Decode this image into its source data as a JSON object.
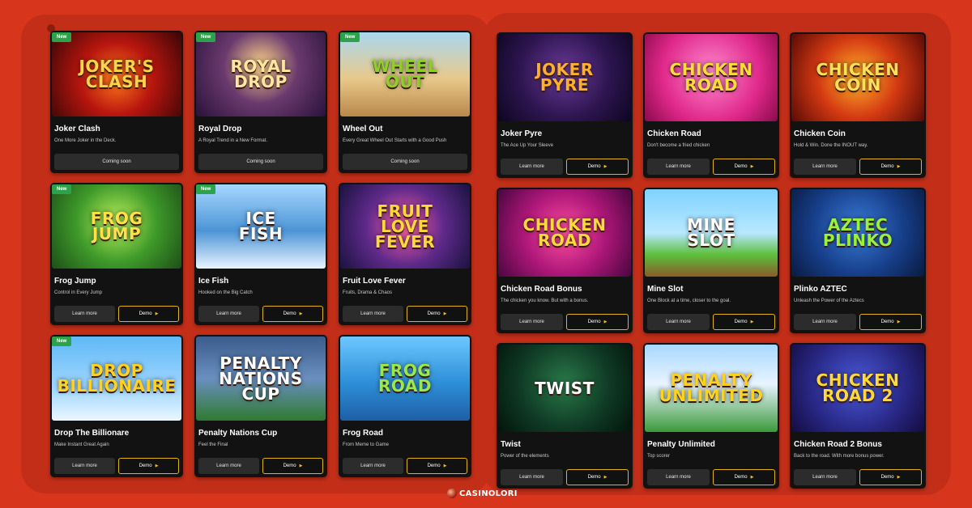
{
  "brand": {
    "logo_text": "CASINOLORI"
  },
  "labels": {
    "learn_more": "Learn more",
    "demo": "Demo",
    "coming_soon": "Coming soon",
    "new_badge": "New"
  },
  "colors": {
    "background": "#d8361c",
    "panel": "#c32e19",
    "card": "#121212",
    "demo_border": "#e2b317",
    "new_badge": "#2ca24b"
  },
  "games_left": [
    {
      "name": "Joker Clash",
      "tagline": "One More Joker in the Deck.",
      "thumb_text": "JOKER'S\nCLASH",
      "status": "coming_soon",
      "is_new": true,
      "bg": "radial-gradient(circle at 50% 55%, #ff7a1a 0%, #b8160f 45%, #3a0606 100%)",
      "fg": "#ffd54a"
    },
    {
      "name": "Royal Drop",
      "tagline": "A Royal Trend in a New Format.",
      "thumb_text": "ROYAL\nDROP",
      "status": "coming_soon",
      "is_new": true,
      "bg": "radial-gradient(circle at 50% 40%, #ffd68a 0%, #6b3a6e 45%, #2a123a 100%)",
      "fg": "#ffe6a0"
    },
    {
      "name": "Wheel Out",
      "tagline": "Every Great Wheel Out Starts with a Good Push",
      "thumb_text": "WHEEL\nOUT",
      "status": "coming_soon",
      "is_new": true,
      "bg": "linear-gradient(180deg, #a9d8f0 0%, #e8c98a 55%, #b9874a 100%)",
      "fg": "#8fcf2a"
    },
    {
      "name": "Frog Jump",
      "tagline": "Control in Every Jump",
      "thumb_text": "FROG\nJUMP",
      "status": "available",
      "is_new": true,
      "bg": "radial-gradient(circle at 50% 45%, #b9ef5a 0%, #3f9a2a 50%, #1d4f18 100%)",
      "fg": "#ffe14a"
    },
    {
      "name": "Ice Fish",
      "tagline": "Hooked on the Big Catch",
      "thumb_text": "ICE\nFISH",
      "status": "available",
      "is_new": true,
      "bg": "linear-gradient(180deg, #a6d8ff 0%, #4c94d6 55%, #e8f4ff 100%)",
      "fg": "#ffffff"
    },
    {
      "name": "Fruit Love Fever",
      "tagline": "Fruits, Drama & Chaos",
      "thumb_text": "FRUIT\nLOVE\nFEVER",
      "status": "available",
      "is_new": false,
      "bg": "radial-gradient(circle at 50% 50%, #ff5fa5 0%, #5f2a8a 50%, #1a1240 100%)",
      "fg": "#ffd83a"
    },
    {
      "name": "Drop The Billionare",
      "tagline": "Make Instant Great Again",
      "thumb_text": "DROP\nBILLIONAIRE",
      "status": "available",
      "is_new": true,
      "bg": "linear-gradient(180deg, #5fb8f5 0%, #9fd6ff 60%, #e9f7ff 100%)",
      "fg": "#ffd21f"
    },
    {
      "name": "Penalty Nations Cup",
      "tagline": "Feel the Final",
      "thumb_text": "PENALTY\nNATIONS CUP",
      "status": "available",
      "is_new": false,
      "bg": "linear-gradient(180deg, #3b5c8c 0%, #6a8fbf 50%, #2f7a2f 100%)",
      "fg": "#ffffff"
    },
    {
      "name": "Frog Road",
      "tagline": "From Meme to Game",
      "thumb_text": "FROG\nROAD",
      "status": "available",
      "is_new": false,
      "bg": "linear-gradient(180deg, #6ec7ff 0%, #2d8fd8 55%, #1e5fa6 100%)",
      "fg": "#9be84a"
    }
  ],
  "games_right": [
    {
      "name": "Joker Pyre",
      "tagline": "The Ace Up Your Sleeve",
      "thumb_text": "JOKER\nPYRE",
      "status": "available",
      "is_new": false,
      "bg": "radial-gradient(circle at 50% 45%, #6c3b9a 0%, #2d1550 55%, #0d0620 100%)",
      "fg": "#ffb02a"
    },
    {
      "name": "Chicken Road",
      "tagline": "Don't become a fried chicken",
      "thumb_text": "CHICKEN\nROAD",
      "status": "available",
      "is_new": false,
      "bg": "radial-gradient(circle at 50% 45%, #ff8ad0 0%, #e0288a 60%, #8a0a4a 100%)",
      "fg": "#ffdc3a"
    },
    {
      "name": "Chicken Coin",
      "tagline": "Hold & Win. Done the INOUT way.",
      "thumb_text": "CHICKEN\nCOIN",
      "status": "available",
      "is_new": false,
      "bg": "radial-gradient(circle at 50% 50%, #ffb52a 0%, #d43a12 50%, #5a0a06 100%)",
      "fg": "#ffe05a"
    },
    {
      "name": "Chicken Road Bonus",
      "tagline": "The chicken you know. But with a bonus.",
      "thumb_text": "CHICKEN\nROAD",
      "status": "available",
      "is_new": false,
      "bg": "radial-gradient(circle at 50% 50%, #ff4fa0 0%, #b0187a 50%, #4a0640 100%)",
      "fg": "#ffd83a"
    },
    {
      "name": "Mine Slot",
      "tagline": "One Block at a time, closer to the goal.",
      "thumb_text": "MINE\nSLOT",
      "status": "available",
      "is_new": false,
      "bg": "linear-gradient(180deg, #7fd2ff 0%, #b8e8ff 50%, #5cbf3a 75%, #8a5a2a 100%)",
      "fg": "#ffffff"
    },
    {
      "name": "Plinko AZTEC",
      "tagline": "Unleash the Power of the Aztecs",
      "thumb_text": "AZTEC\nPLINKO",
      "status": "available",
      "is_new": false,
      "bg": "radial-gradient(circle at 50% 45%, #3a7bd8 0%, #173f8a 55%, #0a1a40 100%)",
      "fg": "#9bf03a"
    },
    {
      "name": "Twist",
      "tagline": "Power of the elements",
      "thumb_text": "TWIST",
      "status": "available",
      "is_new": false,
      "bg": "radial-gradient(circle at 50% 45%, #2a7a4a 0%, #0f3a24 55%, #04140c 100%)",
      "fg": "#ffffff"
    },
    {
      "name": "Penalty Unlimited",
      "tagline": "Top scorer",
      "thumb_text": "PENALTY\nUNLIMITED",
      "status": "available",
      "is_new": false,
      "bg": "linear-gradient(180deg, #a8d8ff 0%, #e8f4ff 45%, #3a9a3a 100%)",
      "fg": "#ffd21f"
    },
    {
      "name": "Chicken Road 2 Bonus",
      "tagline": "Back to the road. With more bonus power.",
      "thumb_text": "CHICKEN\nROAD 2",
      "status": "available",
      "is_new": false,
      "bg": "radial-gradient(circle at 50% 45%, #4a5ad8 0%, #2a2a8a 55%, #140c40 100%)",
      "fg": "#ffd83a"
    }
  ]
}
